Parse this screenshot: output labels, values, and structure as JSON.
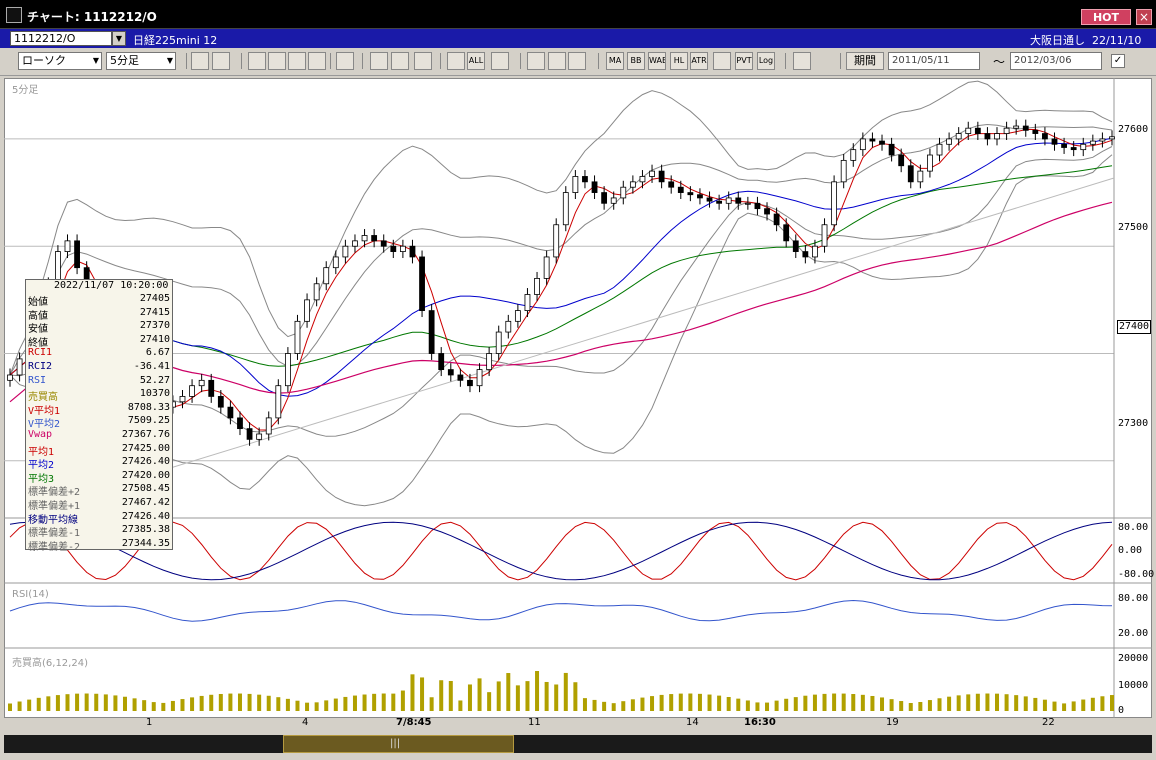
{
  "window": {
    "title": "チャート: 1112212/O",
    "hot_label": "HOT",
    "close_label": "×"
  },
  "info": {
    "symbol": "1112212/O",
    "name": "日経225mini 12",
    "market": "大阪日通し",
    "date": "22/11/10"
  },
  "toolbar": {
    "chart_type": "ローソク",
    "interval": "5分足",
    "period_label": "期間",
    "date_from": "2011/05/11",
    "date_to": "2012/03/06",
    "tilde": "〜",
    "buttons": [
      "zoom",
      "cursor",
      "bookmark",
      "zoomfit",
      "yen",
      "chip",
      "pencil",
      "arrow",
      "undo",
      "candle",
      "lines",
      "all",
      "grid",
      "brush",
      "color",
      "tbl",
      "ma",
      "bb",
      "wae",
      "hl",
      "atr",
      "enve",
      "pvt",
      "log",
      "window"
    ],
    "button_labels": {
      "ma": "MA",
      "bb": "BB",
      "wae": "WAE",
      "hl": "HL",
      "atr": "ATR",
      "pvt": "PVT",
      "log": "Log",
      "all": "ALL"
    }
  },
  "colors": {
    "candle_up": "#ffffff",
    "candle_down": "#000000",
    "rci1": "#cc0000",
    "rci2": "#000080",
    "rsi": "#3355cc",
    "vwap": "#cc0066",
    "ma1": "#cc0000",
    "ma2": "#0000cc",
    "ma3": "#007700",
    "bb": "#888888",
    "volume": "#b0a000"
  },
  "main_panel": {
    "label": "5分足",
    "y_ticks": [
      "27600",
      "27500",
      "27400",
      "27300"
    ],
    "current_price": "27400"
  },
  "rci_panel": {
    "y_ticks": [
      "80.00",
      "0.00",
      "-80.00"
    ]
  },
  "rsi_panel": {
    "label": "RSI(14)",
    "y_ticks": [
      "80.00",
      "20.00"
    ]
  },
  "vol_panel": {
    "label": "売買高(6,12,24)",
    "y_ticks": [
      "20000",
      "10000",
      "0"
    ]
  },
  "x_labels": [
    "1",
    "4",
    "7/8:45",
    "11",
    "14",
    "16:30",
    "19",
    "22"
  ],
  "data_panel": {
    "timestamp": "2022/11/07  10:20:00",
    "rows": [
      {
        "label": "始値",
        "value": "27405",
        "color": "#000000"
      },
      {
        "label": "高値",
        "value": "27415",
        "color": "#000000"
      },
      {
        "label": "安値",
        "value": "27370",
        "color": "#000000"
      },
      {
        "label": "終値",
        "value": "27410",
        "color": "#000000"
      },
      {
        "label": "RCI1",
        "value": "6.67",
        "color": "#cc0000"
      },
      {
        "label": "RCI2",
        "value": "-36.41",
        "color": "#000080"
      },
      {
        "label": "RSI",
        "value": "52.27",
        "color": "#3355cc"
      },
      {
        "label": "売買高",
        "value": "10370",
        "color": "#998800"
      },
      {
        "label": "V平均1",
        "value": "8708.33",
        "color": "#cc0000"
      },
      {
        "label": "V平均2",
        "value": "7509.25",
        "color": "#3355cc"
      },
      {
        "label": "Vwap",
        "value": "27367.76",
        "color": "#cc0066"
      },
      {
        "label": "平均1",
        "value": "27425.00",
        "color": "#cc0000"
      },
      {
        "label": "平均2",
        "value": "27426.40",
        "color": "#0000cc"
      },
      {
        "label": "平均3",
        "value": "27420.00",
        "color": "#007700"
      },
      {
        "label": "標準偏差+2",
        "value": "27508.45",
        "color": "#666666"
      },
      {
        "label": "標準偏差+1",
        "value": "27467.42",
        "color": "#666666"
      },
      {
        "label": "移動平均線",
        "value": "27426.40",
        "color": "#000080"
      },
      {
        "label": "標準偏差-1",
        "value": "27385.38",
        "color": "#666666"
      },
      {
        "label": "標準偏差-2",
        "value": "27344.35",
        "color": "#666666"
      }
    ]
  },
  "chart_data": {
    "type": "candlestick",
    "interval": "5分足",
    "y_range": [
      27270,
      27640
    ],
    "closes": [
      27380,
      27395,
      27410,
      27440,
      27465,
      27495,
      27505,
      27480,
      27450,
      27430,
      27420,
      27400,
      27380,
      27365,
      27350,
      27345,
      27350,
      27355,
      27360,
      27370,
      27375,
      27360,
      27350,
      27340,
      27330,
      27320,
      27325,
      27340,
      27370,
      27400,
      27430,
      27450,
      27465,
      27480,
      27490,
      27500,
      27505,
      27510,
      27505,
      27500,
      27495,
      27500,
      27490,
      27440,
      27400,
      27385,
      27380,
      27375,
      27370,
      27385,
      27400,
      27420,
      27430,
      27440,
      27455,
      27470,
      27490,
      27520,
      27550,
      27565,
      27560,
      27550,
      27540,
      27545,
      27555,
      27560,
      27565,
      27570,
      27560,
      27555,
      27550,
      27548,
      27545,
      27542,
      27540,
      27545,
      27540,
      27540,
      27535,
      27530,
      27520,
      27505,
      27495,
      27490,
      27500,
      27520,
      27560,
      27580,
      27590,
      27600,
      27598,
      27595,
      27585,
      27575,
      27560,
      27570,
      27585,
      27595,
      27600,
      27605,
      27610,
      27605,
      27600,
      27605,
      27610,
      27612,
      27608,
      27605,
      27600,
      27595,
      27592,
      27590,
      27595,
      27598,
      27600,
      27602
    ],
    "rci1_range": [
      -100,
      100
    ],
    "rsi_range": [
      0,
      100
    ],
    "volume_range": [
      0,
      22000
    ]
  }
}
